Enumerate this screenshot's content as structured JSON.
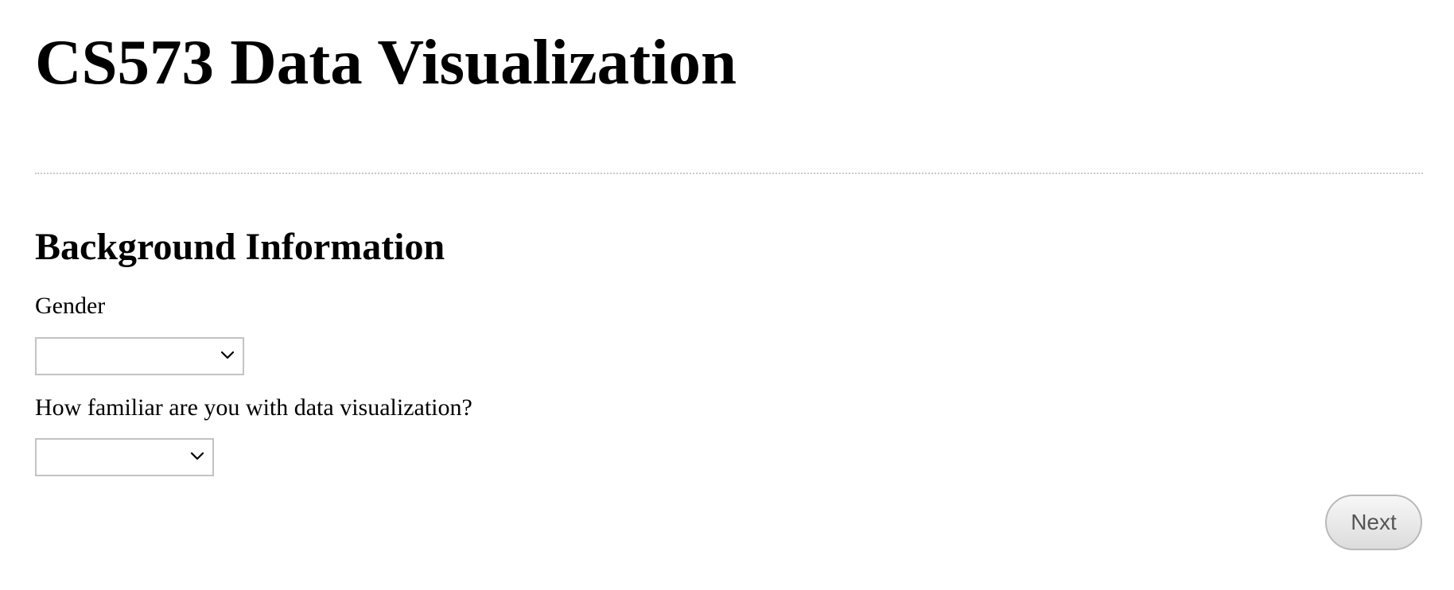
{
  "header": {
    "title": "CS573 Data Visualization"
  },
  "section": {
    "title": "Background Information"
  },
  "form": {
    "gender": {
      "label": "Gender",
      "selected_value": ""
    },
    "familiarity": {
      "label": "How familiar are you with data visualization?",
      "selected_value": ""
    }
  },
  "actions": {
    "next_label": "Next"
  },
  "icons": {
    "dropdown": "chevron-down-icon"
  },
  "colors": {
    "text": "#000000",
    "border": "#c3c3c3",
    "button_text": "#555555",
    "divider": "#c8c8c8"
  }
}
